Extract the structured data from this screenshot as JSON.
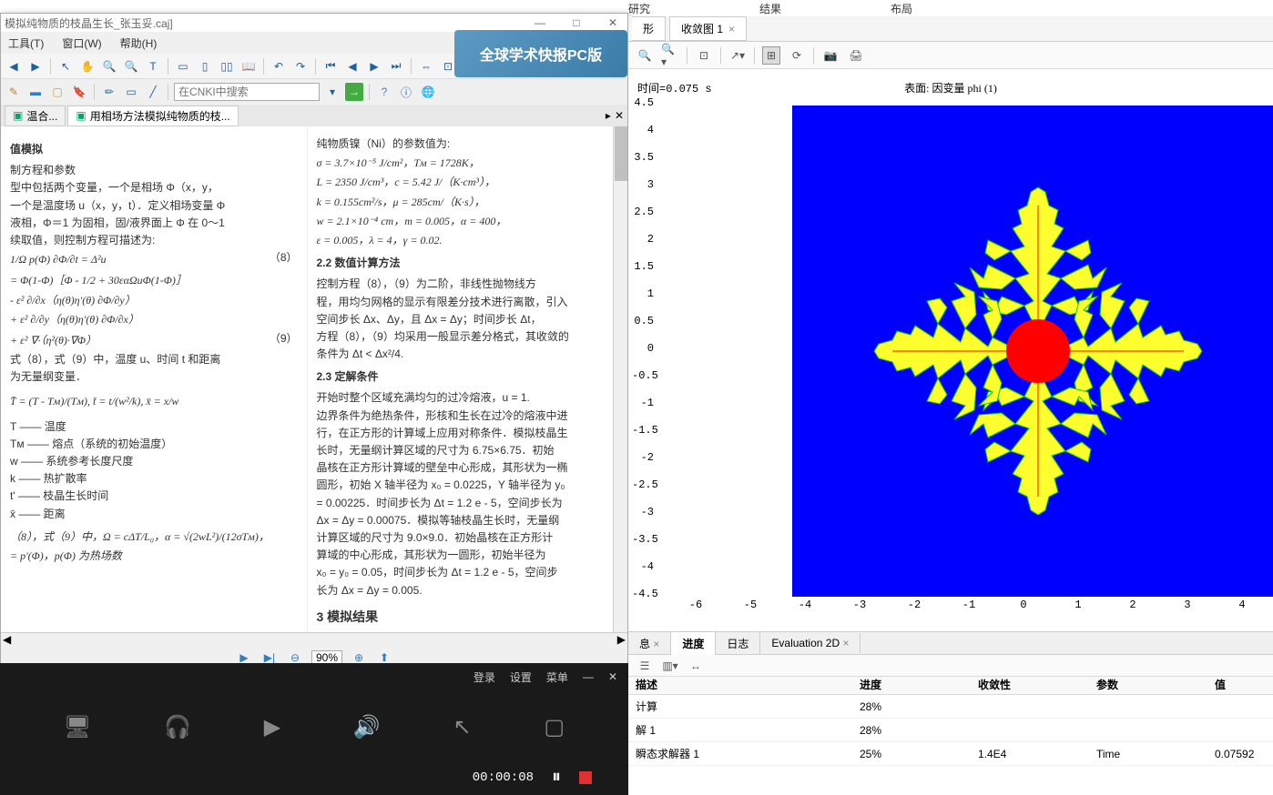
{
  "top_menu": {
    "items": [
      "研究",
      "结果",
      "布局"
    ]
  },
  "caj": {
    "title": "模拟纯物质的枝晶生长_张玉妥.caj]",
    "menu": {
      "tools": "工具(T)",
      "window": "窗口(W)",
      "help": "帮助(H)"
    },
    "tabs": {
      "tab1": "温合...",
      "tab2": "用相场方法模拟纯物质的枝..."
    },
    "search_placeholder": "在CNKI中搜索",
    "promo": "全球学术快报PC版",
    "zoom": "90%",
    "content": {
      "heading1": "值模拟",
      "sec_a": "制方程和参数",
      "para1a": "型中包括两个变量，一个是相场 Φ（x，y，",
      "para1b": "一个是温度场 u（x，y，t）．定义相场变量 Φ",
      "para1c": "液相，Φ＝1 为固相，固/液界面上 Φ 在 0～1",
      "para1d": "续取值，则控制方程可描述为:",
      "formula1": "1/Ω p(Φ) ∂Φ/∂t = Δ²u",
      "formula1_num": "（8）",
      "formula2": "= Φ(1-Φ)［Φ - 1/2 + 30εαΩuΦ(1-Φ)］",
      "formula3": "- ε² ∂/∂x（η(θ)η'(θ) ∂Φ/∂y）",
      "formula4": "+ ε² ∂/∂y（η(θ)η'(θ) ∂Φ/∂x）",
      "formula5": "+ ε² ∇·（η²(θ)·∇Φ）",
      "formula5_num": "（9）",
      "para2": "式（8），式（9）中，温度 u、时间 t 和距离",
      "para3": "为无量纲变量．",
      "formula6": "T̄ = (T - Tм)/(Tм), t̄ = t/(w²/k), x̄ = x/w",
      "def1": "T —— 温度",
      "def2": "Tм —— 熔点（系统的初始温度）",
      "def3": "w —— 系统参考长度尺度",
      "def4": "k —— 热扩散率",
      "def5": "t' —— 枝晶生长时间",
      "def6": "x̄ —— 距离",
      "para4": "（8），式（9）中，Ω = cΔT/L₀，α = √(2wL²)/(12σTм)，",
      "para5": "= p'(Φ)，p(Φ) 为热场数",
      "right_para1": "纯物质镍（Ni）的参数值为:",
      "param1": "σ = 3.7×10⁻⁵ J/cm²，Tм = 1728K，",
      "param2": "L = 2350 J/cm³，c = 5.42 J/（K·cm³），",
      "param3": "k = 0.155cm²/s，μ = 285cm/（K·s），",
      "param4": "w = 2.1×10⁻⁴ cm，m = 0.005，α = 400，",
      "param5": "ε = 0.005，λ = 4，γ = 0.02.",
      "sec22": "2.2  数值计算方法",
      "para6a": "控制方程（8），（9）为二阶，非线性抛物线方",
      "para6b": "程，用均匀网格的显示有限差分技术进行离散，引入",
      "para6c": "空间步长 Δx、Δy，且 Δx = Δy；时间步长 Δt，",
      "para6d": "方程（8），（9）均采用一般显示差分格式，其收敛的",
      "para6e": "条件为 Δt < Δx²/4.",
      "sec23": "2.3  定解条件",
      "para7a": "开始时整个区域充满均匀的过冷熔液，u = 1.",
      "para7b": "边界条件为绝热条件，形核和生长在过冷的熔液中进",
      "para7c": "行，在正方形的计算域上应用对称条件．模拟枝晶生",
      "para7d": "长时，无量纲计算区域的尺寸为 6.75×6.75．初始",
      "para7e": "晶核在正方形计算域的壁垒中心形成，其形状为一椭",
      "para7f": "圆形，初始 X 轴半径为 x₀ = 0.0225，Y 轴半径为 y₀",
      "para7g": "= 0.00225．时间步长为 Δt = 1.2 e - 5，空间步长为",
      "para7h": "Δx = Δy = 0.00075．模拟等轴枝晶生长时，无量纲",
      "para7i": "计算区域的尺寸为 9.0×9.0．初始晶核在正方形计",
      "para7j": "算域的中心形成，其形状为一圆形，初始半径为",
      "para7k": "x₀ = y₀ = 0.05，时间步长为 Δt = 1.2 e - 5，空间步",
      "para7l": "长为 Δx = Δy = 0.005.",
      "sec3": "3  模拟结果"
    }
  },
  "comsol": {
    "tab_left": "形",
    "tab_name": "收敛图 1",
    "plot_time_label": "时间=0.075 s",
    "plot_title": "表面: 因变量 phi (1)",
    "bottom_tabs": {
      "info": "息",
      "progress": "进度",
      "log": "日志",
      "eval": "Evaluation 2D"
    },
    "progress": {
      "headers": {
        "desc": "描述",
        "prog": "进度",
        "conv": "收敛性",
        "param": "参数",
        "val": "值"
      },
      "rows": [
        {
          "desc": "计算",
          "prog": "28%",
          "conv": "",
          "param": "",
          "val": ""
        },
        {
          "desc": "解 1",
          "prog": "28%",
          "conv": "",
          "param": "",
          "val": ""
        },
        {
          "desc": "瞬态求解器 1",
          "prog": "25%",
          "conv": "1.4E4",
          "param": "Time",
          "val": "0.07592"
        }
      ]
    }
  },
  "chart_data": {
    "type": "heatmap",
    "title": "表面: 因变量 phi (1)",
    "time_label": "时间=0.075 s",
    "xlabel": "",
    "ylabel": "",
    "xlim": [
      -6.75,
      4.5
    ],
    "ylim": [
      -4.5,
      4.5
    ],
    "x_ticks": [
      -6,
      -5,
      -4,
      -3,
      -2,
      -1,
      0,
      1,
      2,
      3,
      4
    ],
    "y_ticks": [
      -4.5,
      -4,
      -3.5,
      -3,
      -2.5,
      -2,
      -1.5,
      -1,
      -0.5,
      0,
      0.5,
      1,
      1.5,
      2,
      2.5,
      3,
      3.5,
      4,
      4.5
    ],
    "description": "Phase-field dendrite growth simulation: 4-fold symmetric dendritic crystal centered near (1,0); solid core (phi≈1, red) radius ~0.5, dendritic arms along ±x,±y axes extending ~2.5 units with secondary side-branches (yellow-green, phi≈0.3-0.7), undercooled liquid background (phi≈0, blue)."
  },
  "recorder": {
    "login": "登录",
    "settings": "设置",
    "menu": "菜单",
    "time": "00:00:08"
  }
}
